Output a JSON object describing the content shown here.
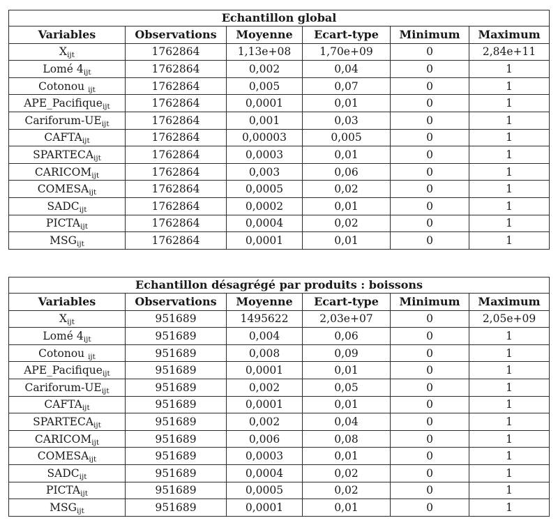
{
  "columns": [
    "Variables",
    "Observations",
    "Moyenne",
    "Ecart-type",
    "Minimum",
    "Maximum"
  ],
  "tables": [
    {
      "title": "Echantillon global",
      "rows": [
        {
          "var": "X",
          "sub": "ijt",
          "obs": "1762864",
          "mean": "1,13e+08",
          "sd": "1,70e+09",
          "min": "0",
          "max": "2,84e+11"
        },
        {
          "var": "Lomé 4",
          "sub": "ijt",
          "obs": "1762864",
          "mean": "0,002",
          "sd": "0,04",
          "min": "0",
          "max": "1"
        },
        {
          "var": "Cotonou ",
          "sub": "ijt",
          "obs": "1762864",
          "mean": "0,005",
          "sd": "0,07",
          "min": "0",
          "max": "1"
        },
        {
          "var": "APE_Pacifique",
          "sub": "ijt",
          "obs": "1762864",
          "mean": "0,0001",
          "sd": "0,01",
          "min": "0",
          "max": "1"
        },
        {
          "var": "Cariforum-UE",
          "sub": "ijt",
          "obs": "1762864",
          "mean": "0,001",
          "sd": "0,03",
          "min": "0",
          "max": "1"
        },
        {
          "var": "CAFTA",
          "sub": "ijt",
          "obs": "1762864",
          "mean": "0,00003",
          "sd": "0,005",
          "min": "0",
          "max": "1"
        },
        {
          "var": "SPARTECA",
          "sub": "ijt",
          "obs": "1762864",
          "mean": "0,0003",
          "sd": "0,01",
          "min": "0",
          "max": "1"
        },
        {
          "var": "CARICOM",
          "sub": "ijt",
          "obs": "1762864",
          "mean": "0,003",
          "sd": "0,06",
          "min": "0",
          "max": "1"
        },
        {
          "var": "COMESA",
          "sub": "ijt",
          "obs": "1762864",
          "mean": "0,0005",
          "sd": "0,02",
          "min": "0",
          "max": "1"
        },
        {
          "var": "SADC",
          "sub": "ijt",
          "obs": "1762864",
          "mean": "0,0002",
          "sd": "0,01",
          "min": "0",
          "max": "1"
        },
        {
          "var": "PICTA",
          "sub": "ijt",
          "obs": "1762864",
          "mean": "0,0004",
          "sd": "0,02",
          "min": "0",
          "max": "1"
        },
        {
          "var": "MSG",
          "sub": "ijt",
          "obs": "1762864",
          "mean": "0,0001",
          "sd": "0,01",
          "min": "0",
          "max": "1"
        }
      ]
    },
    {
      "title": "Echantillon désagrégé par produits : boissons",
      "rows": [
        {
          "var": "X",
          "sub": "ijt",
          "obs": "951689",
          "mean": "1495622",
          "sd": "2,03e+07",
          "min": "0",
          "max": "2,05e+09"
        },
        {
          "var": "Lomé 4",
          "sub": "ijt",
          "obs": "951689",
          "mean": "0,004",
          "sd": "0,06",
          "min": "0",
          "max": "1"
        },
        {
          "var": "Cotonou ",
          "sub": "ijt",
          "obs": "951689",
          "mean": "0,008",
          "sd": "0,09",
          "min": "0",
          "max": "1"
        },
        {
          "var": "APE_Pacifique",
          "sub": "ijt",
          "obs": "951689",
          "mean": "0,0001",
          "sd": "0,01",
          "min": "0",
          "max": "1"
        },
        {
          "var": "Cariforum-UE",
          "sub": "ijt",
          "obs": "951689",
          "mean": "0,002",
          "sd": "0,05",
          "min": "0",
          "max": "1"
        },
        {
          "var": "CAFTA",
          "sub": "ijt",
          "obs": "951689",
          "mean": "0,0001",
          "sd": "0,01",
          "min": "0",
          "max": "1"
        },
        {
          "var": "SPARTECA",
          "sub": "ijt",
          "obs": "951689",
          "mean": "0,002",
          "sd": "0,04",
          "min": "0",
          "max": "1"
        },
        {
          "var": "CARICOM",
          "sub": "ijt",
          "obs": "951689",
          "mean": "0,006",
          "sd": "0,08",
          "min": "0",
          "max": "1"
        },
        {
          "var": "COMESA",
          "sub": "ijt",
          "obs": "951689",
          "mean": "0,0003",
          "sd": "0,01",
          "min": "0",
          "max": "1"
        },
        {
          "var": "SADC",
          "sub": "ijt",
          "obs": "951689",
          "mean": "0,0004",
          "sd": "0,02",
          "min": "0",
          "max": "1"
        },
        {
          "var": "PICTA",
          "sub": "ijt",
          "obs": "951689",
          "mean": "0,0005",
          "sd": "0,02",
          "min": "0",
          "max": "1"
        },
        {
          "var": "MSG",
          "sub": "ijt",
          "obs": "951689",
          "mean": "0,0001",
          "sd": "0,01",
          "min": "0",
          "max": "1"
        }
      ]
    }
  ]
}
